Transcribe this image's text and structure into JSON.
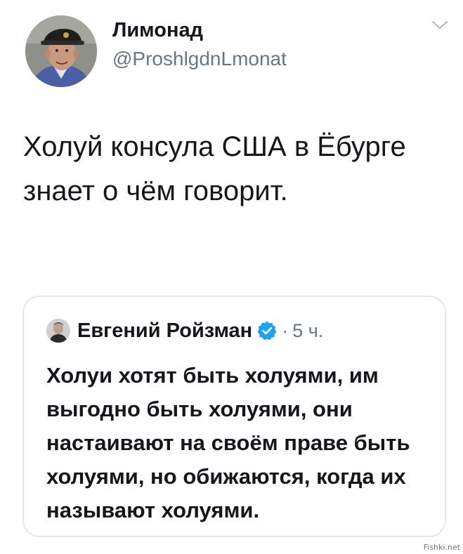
{
  "tweet": {
    "author_name": "Лимонад",
    "author_handle": "@ProshlgdnLmonat",
    "text": "Холуй консула США в Ёбурге  знает о чём говорит.",
    "avatar_icon": "user-avatar-icon",
    "more_icon": "chevron-down-icon"
  },
  "quoted_tweet": {
    "author_name": "Евгений Ройзман",
    "verified_icon": "verified-badge-icon",
    "separator": "·",
    "time": "5 ч.",
    "text": "Холуи хотят быть холуями, им выгодно быть холуями, они настаивают на своём праве быть холуями, но обижаются, когда их называют холуями."
  },
  "watermark": "Fishki.net",
  "colors": {
    "text": "#14171a",
    "secondary": "#657786",
    "border": "#e1e8ed",
    "verified": "#1da1f2"
  }
}
